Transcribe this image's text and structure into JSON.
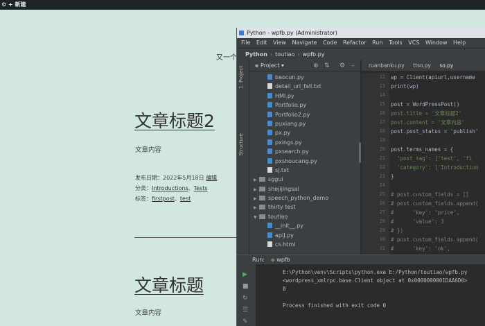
{
  "admin_bar": {
    "new_label": "+ 新建"
  },
  "site": {
    "tagline": "又一个"
  },
  "posts": [
    {
      "title": "文章标题2",
      "content": "文章内容",
      "date_label": "发布日期：2022年5月18日",
      "edit_label": "编辑",
      "category_label": "分类：",
      "categories": [
        "Introductions",
        "Tests"
      ],
      "tag_label": "标签：",
      "tags": [
        "firstpost",
        "test"
      ]
    },
    {
      "title": "文章标题",
      "content": "文章内容"
    }
  ],
  "ide": {
    "window_title": "Python - wpfb.py (Administrator)",
    "menu": [
      "File",
      "Edit",
      "View",
      "Navigate",
      "Code",
      "Refactor",
      "Run",
      "Tools",
      "VCS",
      "Window",
      "Help"
    ],
    "breadcrumb": [
      "Python",
      "toutiao",
      "wpfb.py"
    ],
    "project_label": "Project",
    "side_tabs": [
      "1: Project",
      "Structure"
    ],
    "tree": [
      {
        "name": "baocun.py",
        "kind": "py",
        "indent": 2
      },
      {
        "name": "detail_url_fail.txt",
        "kind": "txt",
        "indent": 2
      },
      {
        "name": "HMI.py",
        "kind": "py",
        "indent": 2
      },
      {
        "name": "Portfolio.py",
        "kind": "py",
        "indent": 2
      },
      {
        "name": "Portfolio2.py",
        "kind": "py",
        "indent": 2
      },
      {
        "name": "puxiang.py",
        "kind": "py",
        "indent": 2
      },
      {
        "name": "px.py",
        "kind": "py",
        "indent": 2
      },
      {
        "name": "pxings.py",
        "kind": "py",
        "indent": 2
      },
      {
        "name": "pxsearch.py",
        "kind": "py",
        "indent": 2
      },
      {
        "name": "pxshoucang.py",
        "kind": "py",
        "indent": 2
      },
      {
        "name": "sj.txt",
        "kind": "txt",
        "indent": 2
      },
      {
        "name": "sggui",
        "kind": "folder",
        "indent": 1
      },
      {
        "name": "shejijingsai",
        "kind": "folder",
        "indent": 1
      },
      {
        "name": "speech_python_demo",
        "kind": "folder",
        "indent": 1
      },
      {
        "name": "thirty test",
        "kind": "folder",
        "indent": 1
      },
      {
        "name": "toutiao",
        "kind": "folder-open",
        "indent": 1
      },
      {
        "name": "__init__.py",
        "kind": "py",
        "indent": 2
      },
      {
        "name": "apiJ.py",
        "kind": "py",
        "indent": 2
      },
      {
        "name": "cs.html",
        "kind": "txt",
        "indent": 2
      }
    ],
    "tabs": [
      "ruanbanku.py",
      "ttso.py",
      "so.py"
    ],
    "gutter": [
      "12",
      "13",
      "14",
      "15",
      "16",
      "17",
      "18",
      "19",
      "20",
      "21",
      "22",
      "23",
      "24",
      "25",
      "26",
      "27",
      "28",
      "29",
      "30",
      "31"
    ],
    "code": [
      {
        "text": "wp = Client(apiurl,username",
        "cls": ""
      },
      {
        "text": "print(wp)",
        "cls": ""
      },
      {
        "text": "",
        "cls": ""
      },
      {
        "text": "post = WordPressPost()",
        "cls": ""
      },
      {
        "text": "post.title = '文章标题2'",
        "cls": "st"
      },
      {
        "text": "post.content = '文章内容'",
        "cls": "st"
      },
      {
        "text": "post.post_status = 'publish'",
        "cls": ""
      },
      {
        "text": "",
        "cls": ""
      },
      {
        "text": "post.terms_names = {",
        "cls": ""
      },
      {
        "text": "  'post_tag': ['test', 'fi",
        "cls": "st"
      },
      {
        "text": "  'category': ['Introduction",
        "cls": "st"
      },
      {
        "text": "}",
        "cls": ""
      },
      {
        "text": "",
        "cls": ""
      },
      {
        "text": "# post.custom_fields = []",
        "cls": "cm"
      },
      {
        "text": "# post.custom_fields.append(",
        "cls": "cm"
      },
      {
        "text": "#      'key': 'price',",
        "cls": "cm"
      },
      {
        "text": "#      'value': 3",
        "cls": "cm"
      },
      {
        "text": "# })",
        "cls": "cm"
      },
      {
        "text": "# post.custom_fields.append(",
        "cls": "cm"
      },
      {
        "text": "#      'key': 'ok',",
        "cls": "cm"
      }
    ],
    "run": {
      "label": "Run:",
      "config": "wpfb",
      "lines": [
        "E:\\Python\\venv\\Scripts\\python.exe E:/Python/toutiao/wpfb.py",
        "<wordpress_xmlrpc.base.Client object at 0x0000000001DAA6D0>",
        "8",
        "",
        "Process finished with exit code 0"
      ]
    }
  }
}
